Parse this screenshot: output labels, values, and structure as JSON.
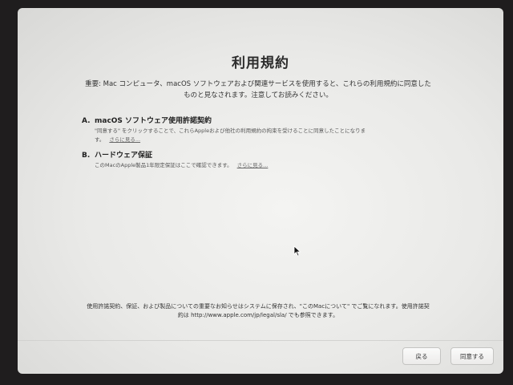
{
  "title": "利用規約",
  "intro": {
    "line1": "重要: Mac コンピュータ、macOS ソフトウェアおよび関連サービスを使用すると、これらの利用規約に同意した",
    "line2": "ものと見なされます。注意してお読みください。"
  },
  "sections": [
    {
      "letter": "A.",
      "heading": "macOS ソフトウェア使用許諾契約",
      "body_line1": "\"同意する\" をクリックすることで、これらAppleおよび他社の利用規約の拘束を受けることに同意したことになりま",
      "body_line2": "す。",
      "more_link": "さらに見る..."
    },
    {
      "letter": "B.",
      "heading": "ハードウェア保証",
      "body_line1": "このMacのApple製品1年限定保証はここで確認できます。",
      "more_link": "さらに見る..."
    }
  ],
  "footer": {
    "line1": "使用許諾契約、保証、および製品についての重要なお知らせはシステムに保存され、\"このMacについて\" でご覧になれます。使用許諾契",
    "line2": "約は http://www.apple.com/jp/legal/sla/ でも参照できます。"
  },
  "buttons": {
    "back": "戻る",
    "agree": "同意する"
  }
}
